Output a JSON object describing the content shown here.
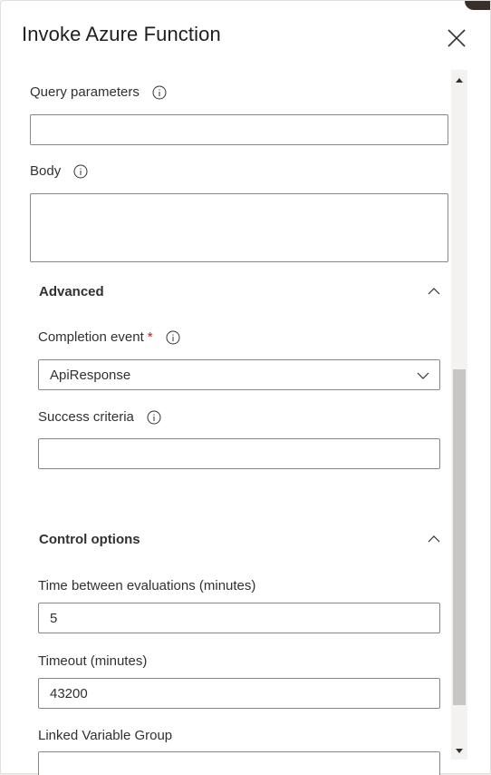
{
  "dialog": {
    "title": "Invoke Azure Function"
  },
  "fields": {
    "query_parameters": {
      "label": "Query parameters",
      "value": ""
    },
    "body": {
      "label": "Body",
      "value": ""
    },
    "completion_event": {
      "label": "Completion event",
      "required_mark": "*",
      "value": "ApiResponse"
    },
    "success_criteria": {
      "label": "Success criteria",
      "value": ""
    },
    "time_between_evaluations": {
      "label": "Time between evaluations (minutes)",
      "value": "5"
    },
    "timeout": {
      "label": "Timeout (minutes)",
      "value": "43200"
    },
    "linked_variable_group": {
      "label": "Linked Variable Group",
      "value": ""
    }
  },
  "sections": {
    "advanced": {
      "title": "Advanced"
    },
    "control_options": {
      "title": "Control options"
    }
  },
  "icons": {
    "close": "close-icon",
    "info": "info-icon",
    "chevron_up": "chevron-up-icon",
    "chevron_down": "chevron-down-icon"
  },
  "colors": {
    "required": "#a4262c",
    "border": "#8a8886",
    "scroll_thumb": "#c8c6c4"
  }
}
